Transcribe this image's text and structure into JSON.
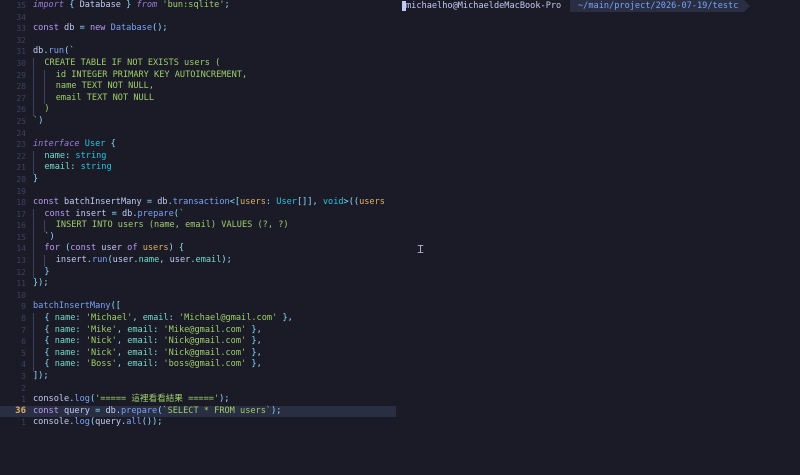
{
  "editor": {
    "lines": [
      {
        "ln": "35",
        "segs": [
          [
            "kw",
            "import"
          ],
          [
            "punc",
            " { "
          ],
          [
            "var",
            "Database"
          ],
          [
            "punc",
            " } "
          ],
          [
            "kw",
            "from"
          ],
          [
            "plain",
            " "
          ],
          [
            "str",
            "'bun:sqlite'"
          ],
          [
            "punc",
            ";"
          ]
        ]
      },
      {
        "ln": "34",
        "segs": []
      },
      {
        "ln": "33",
        "segs": [
          [
            "kw2",
            "const"
          ],
          [
            "var",
            " db "
          ],
          [
            "punc",
            "= "
          ],
          [
            "kw2",
            "new "
          ],
          [
            "fn",
            "Database"
          ],
          [
            "punc",
            "();"
          ]
        ]
      },
      {
        "ln": "32",
        "segs": []
      },
      {
        "ln": "31",
        "segs": [
          [
            "var",
            "db"
          ],
          [
            "punc",
            "."
          ],
          [
            "fn",
            "run"
          ],
          [
            "punc",
            "("
          ],
          [
            "sql",
            "`"
          ]
        ]
      },
      {
        "ln": "30",
        "guides": 1,
        "segs": [
          [
            "sql",
            "CREATE TABLE IF NOT EXISTS users ("
          ]
        ]
      },
      {
        "ln": "29",
        "guides": 2,
        "segs": [
          [
            "sql",
            "id INTEGER PRIMARY KEY AUTOINCREMENT,"
          ]
        ]
      },
      {
        "ln": "28",
        "guides": 2,
        "segs": [
          [
            "sql",
            "name TEXT NOT NULL,"
          ]
        ]
      },
      {
        "ln": "27",
        "guides": 2,
        "segs": [
          [
            "sql",
            "email TEXT NOT NULL"
          ]
        ]
      },
      {
        "ln": "26",
        "guides": 1,
        "segs": [
          [
            "sql",
            ")"
          ]
        ]
      },
      {
        "ln": "25",
        "segs": [
          [
            "sql",
            "`"
          ],
          [
            "punc",
            ")"
          ]
        ]
      },
      {
        "ln": "24",
        "segs": []
      },
      {
        "ln": "23",
        "segs": [
          [
            "kw",
            "interface"
          ],
          [
            "plain",
            " "
          ],
          [
            "type",
            "User"
          ],
          [
            "punc",
            " {"
          ]
        ]
      },
      {
        "ln": "22",
        "guides": 1,
        "segs": [
          [
            "prop",
            "name"
          ],
          [
            "punc",
            ": "
          ],
          [
            "type",
            "string"
          ]
        ]
      },
      {
        "ln": "21",
        "guides": 1,
        "segs": [
          [
            "prop",
            "email"
          ],
          [
            "punc",
            ": "
          ],
          [
            "type",
            "string"
          ]
        ]
      },
      {
        "ln": "20",
        "segs": [
          [
            "punc",
            "}"
          ]
        ]
      },
      {
        "ln": "19",
        "segs": []
      },
      {
        "ln": "18",
        "segs": [
          [
            "kw2",
            "const"
          ],
          [
            "var",
            " batchInsertMany "
          ],
          [
            "punc",
            "= "
          ],
          [
            "var",
            "db"
          ],
          [
            "punc",
            "."
          ],
          [
            "fn",
            "transaction"
          ],
          [
            "punc",
            "<["
          ],
          [
            "param",
            "users"
          ],
          [
            "punc",
            ": "
          ],
          [
            "type",
            "User"
          ],
          [
            "punc",
            "[]], "
          ],
          [
            "type",
            "void"
          ],
          [
            "punc",
            ">(("
          ],
          [
            "param",
            "users"
          ]
        ]
      },
      {
        "ln": "17",
        "guides": 1,
        "segs": [
          [
            "kw2",
            "const"
          ],
          [
            "var",
            " insert "
          ],
          [
            "punc",
            "= "
          ],
          [
            "var",
            "db"
          ],
          [
            "punc",
            "."
          ],
          [
            "fn",
            "prepare"
          ],
          [
            "punc",
            "("
          ],
          [
            "sql",
            "`"
          ]
        ]
      },
      {
        "ln": "16",
        "guides": 2,
        "segs": [
          [
            "sql",
            "INSERT INTO users (name, email) VALUES (?, ?)"
          ]
        ]
      },
      {
        "ln": "15",
        "guides": 1,
        "segs": [
          [
            "sql",
            "`"
          ],
          [
            "punc",
            ")"
          ]
        ]
      },
      {
        "ln": "14",
        "guides": 1,
        "segs": [
          [
            "kw2",
            "for"
          ],
          [
            "punc",
            " ("
          ],
          [
            "kw2",
            "const"
          ],
          [
            "var",
            " user "
          ],
          [
            "kw2",
            "of"
          ],
          [
            "param",
            " users"
          ],
          [
            "punc",
            ") {"
          ]
        ]
      },
      {
        "ln": "13",
        "guides": 2,
        "segs": [
          [
            "var",
            "insert"
          ],
          [
            "punc",
            "."
          ],
          [
            "fn",
            "run"
          ],
          [
            "punc",
            "("
          ],
          [
            "var",
            "user"
          ],
          [
            "punc",
            "."
          ],
          [
            "prop",
            "name"
          ],
          [
            "punc",
            ", "
          ],
          [
            "var",
            "user"
          ],
          [
            "punc",
            "."
          ],
          [
            "prop",
            "email"
          ],
          [
            "punc",
            ");"
          ]
        ]
      },
      {
        "ln": "12",
        "guides": 1,
        "segs": [
          [
            "punc",
            "}"
          ]
        ]
      },
      {
        "ln": "11",
        "segs": [
          [
            "punc",
            "});"
          ]
        ]
      },
      {
        "ln": "10",
        "segs": []
      },
      {
        "ln": "9",
        "segs": [
          [
            "fn",
            "batchInsertMany"
          ],
          [
            "punc",
            "(["
          ]
        ]
      },
      {
        "ln": "8",
        "guides": 1,
        "segs": [
          [
            "punc",
            "{ "
          ],
          [
            "prop",
            "name"
          ],
          [
            "punc",
            ": "
          ],
          [
            "str",
            "'Michael'"
          ],
          [
            "punc",
            ", "
          ],
          [
            "prop",
            "email"
          ],
          [
            "punc",
            ": "
          ],
          [
            "str",
            "'Michael@gmail.com'"
          ],
          [
            "punc",
            " },"
          ]
        ]
      },
      {
        "ln": "7",
        "guides": 1,
        "segs": [
          [
            "punc",
            "{ "
          ],
          [
            "prop",
            "name"
          ],
          [
            "punc",
            ": "
          ],
          [
            "str",
            "'Mike'"
          ],
          [
            "punc",
            ", "
          ],
          [
            "prop",
            "email"
          ],
          [
            "punc",
            ": "
          ],
          [
            "str",
            "'Mike@gmail.com'"
          ],
          [
            "punc",
            " },"
          ]
        ]
      },
      {
        "ln": "6",
        "guides": 1,
        "segs": [
          [
            "punc",
            "{ "
          ],
          [
            "prop",
            "name"
          ],
          [
            "punc",
            ": "
          ],
          [
            "str",
            "'Nick'"
          ],
          [
            "punc",
            ", "
          ],
          [
            "prop",
            "email"
          ],
          [
            "punc",
            ": "
          ],
          [
            "str",
            "'Nick@gmail.com'"
          ],
          [
            "punc",
            " },"
          ]
        ]
      },
      {
        "ln": "5",
        "guides": 1,
        "segs": [
          [
            "punc",
            "{ "
          ],
          [
            "prop",
            "name"
          ],
          [
            "punc",
            ": "
          ],
          [
            "str",
            "'Nick'"
          ],
          [
            "punc",
            ", "
          ],
          [
            "prop",
            "email"
          ],
          [
            "punc",
            ": "
          ],
          [
            "str",
            "'Nick@gmail.com'"
          ],
          [
            "punc",
            " },"
          ]
        ]
      },
      {
        "ln": "4",
        "guides": 1,
        "segs": [
          [
            "punc",
            "{ "
          ],
          [
            "prop",
            "name"
          ],
          [
            "punc",
            ": "
          ],
          [
            "str",
            "'Boss'"
          ],
          [
            "punc",
            ", "
          ],
          [
            "prop",
            "email"
          ],
          [
            "punc",
            ": "
          ],
          [
            "str",
            "'boss@gmail.com'"
          ],
          [
            "punc",
            " },"
          ]
        ]
      },
      {
        "ln": "3",
        "segs": [
          [
            "punc",
            "]);"
          ]
        ]
      },
      {
        "ln": "2",
        "segs": []
      },
      {
        "ln": "1",
        "segs": [
          [
            "var",
            "console"
          ],
          [
            "punc",
            "."
          ],
          [
            "fn",
            "log"
          ],
          [
            "punc",
            "("
          ],
          [
            "str",
            "'===== 這裡看看結果 ====='"
          ],
          [
            "punc",
            ");"
          ]
        ]
      },
      {
        "ln": "36",
        "current": true,
        "segs": [
          [
            "kw2",
            "const"
          ],
          [
            "var",
            " query "
          ],
          [
            "punc",
            "= "
          ],
          [
            "var",
            "db"
          ],
          [
            "punc",
            "."
          ],
          [
            "fn",
            "prepare"
          ],
          [
            "punc",
            "("
          ],
          [
            "sql",
            "`SELECT * FROM users`"
          ],
          [
            "punc",
            ");"
          ]
        ]
      },
      {
        "ln": "1",
        "segs": [
          [
            "var",
            "console"
          ],
          [
            "punc",
            "."
          ],
          [
            "fn",
            "log"
          ],
          [
            "punc",
            "("
          ],
          [
            "var",
            "query"
          ],
          [
            "punc",
            "."
          ],
          [
            "fn",
            "all"
          ],
          [
            "punc",
            "());"
          ]
        ]
      }
    ]
  },
  "terminal": {
    "user_host": "michaelho@MichaeldeMacBook-Pro",
    "path": "~/main/project/2026-07-19/testc"
  },
  "colors": {
    "background": "#1a1b26",
    "cursorline": "#292e42",
    "current_line_number": "#e0af68"
  }
}
